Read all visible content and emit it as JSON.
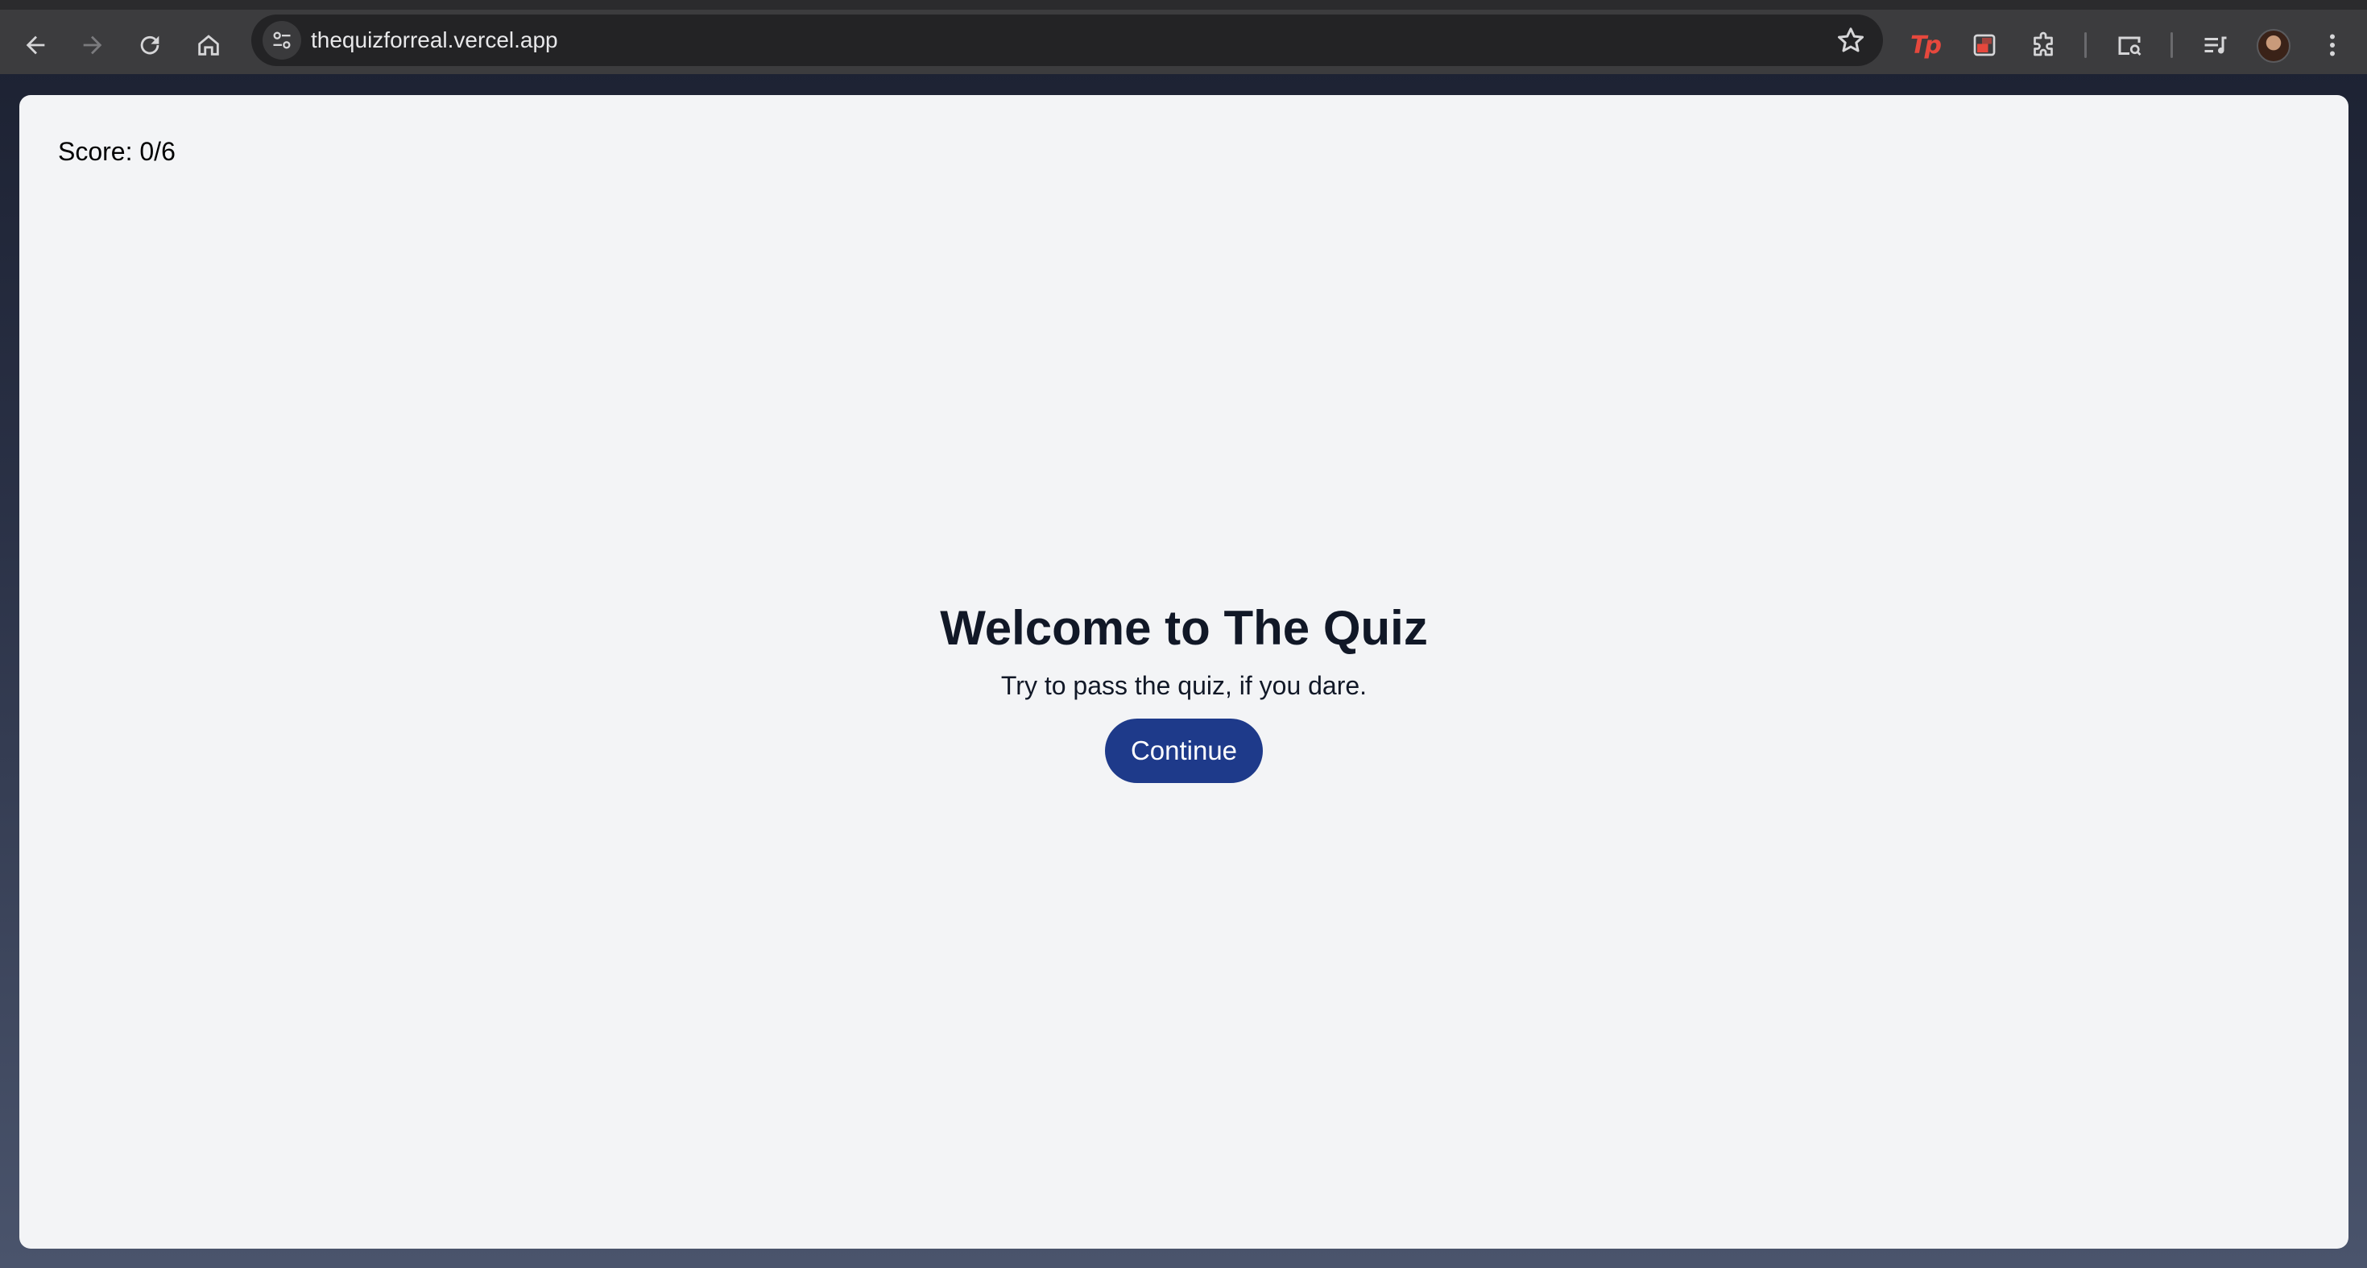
{
  "browser": {
    "url": "thequizforreal.vercel.app",
    "icons": {
      "back": "arrow-left-icon",
      "forward": "arrow-right-icon",
      "reload": "reload-icon",
      "home": "home-icon",
      "site_info": "tune-icon",
      "bookmark": "star-icon",
      "extensions": [
        "tp-extension-icon",
        "video-extension-icon",
        "puzzle-icon",
        "tab-search-icon",
        "media-control-icon",
        "profile-avatar",
        "more-menu-icon"
      ]
    },
    "extension_tp_label": "Tp"
  },
  "page": {
    "score": "Score: 0/6",
    "title": "Welcome to The Quiz",
    "subtitle": "Try to pass the quiz, if you dare.",
    "continue_label": "Continue"
  },
  "colors": {
    "page_bg": "#f3f4f6",
    "button_bg": "#1e3a8a",
    "heading": "#111827",
    "toolbar": "#3c3c3e",
    "omnibox": "#232325"
  }
}
